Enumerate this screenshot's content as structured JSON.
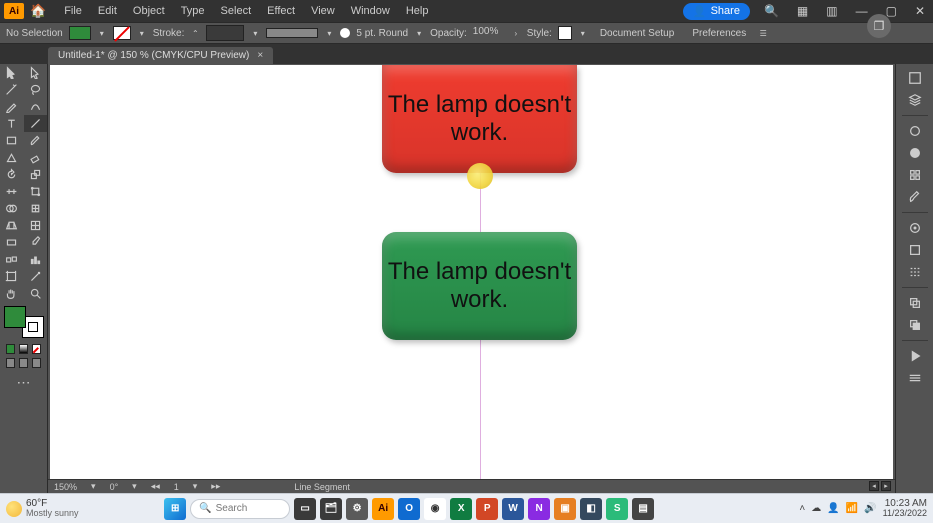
{
  "menubar": {
    "items": [
      "File",
      "Edit",
      "Object",
      "Type",
      "Select",
      "Effect",
      "View",
      "Window",
      "Help"
    ],
    "share": "Share"
  },
  "controlbar": {
    "selection": "No Selection",
    "stroke_label": "Stroke:",
    "brush_label": "5 pt. Round",
    "opacity_label": "Opacity:",
    "opacity_value": "100%",
    "style_label": "Style:",
    "doc_setup": "Document Setup",
    "preferences": "Preferences"
  },
  "tab": {
    "title": "Untitled-1* @ 150 % (CMYK/CPU Preview)",
    "close": "×"
  },
  "canvas": {
    "box1_text": "The lamp doesn't work.",
    "box2_text": "The lamp doesn't work."
  },
  "status": {
    "zoom": "150%",
    "rotate": "0°",
    "artboard": "1",
    "tool": "Line Segment"
  },
  "taskbar": {
    "temp": "60°F",
    "cond": "Mostly sunny",
    "search_placeholder": "Search",
    "time": "10:23 AM",
    "date": "11/23/2022"
  }
}
